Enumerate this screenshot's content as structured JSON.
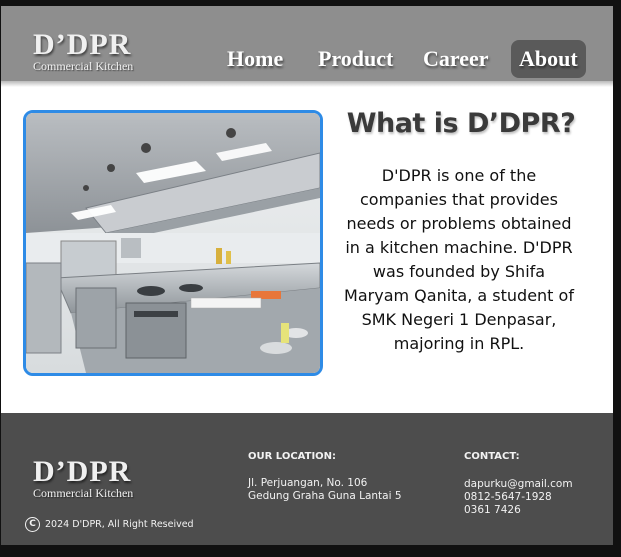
{
  "brand": {
    "name": "D’DPR",
    "tagline": "Commercial Kitchen"
  },
  "nav": {
    "items": [
      {
        "label": "Home",
        "active": false
      },
      {
        "label": "Product",
        "active": false
      },
      {
        "label": "Career",
        "active": false
      },
      {
        "label": "About",
        "active": true
      }
    ]
  },
  "hero": {
    "image_alt": "commercial kitchen photo",
    "title": "What is D’DPR?",
    "description": "D'DPR is one of the companies that provides needs or problems obtained in a kitchen machine. D'DPR was founded by Shifa Maryam Qanita, a student of SMK Negeri 1 Denpasar, majoring in RPL."
  },
  "footer": {
    "brand": {
      "name": "D’DPR",
      "tagline": "Commercial Kitchen"
    },
    "location": {
      "heading": "OUR LOCATION:",
      "line1": "Jl. Perjuangan, No. 106",
      "line2": "Gedung Graha Guna Lantai 5"
    },
    "contact": {
      "heading": "CONTACT:",
      "email": "dapurku@gmail.com",
      "phone1": "0812-5647-1928",
      "phone2": "0361 7426"
    },
    "copyright": "2024 D'DPR, All Right Reseived"
  },
  "colors": {
    "navbar": "#8e8e8e",
    "footer": "#4d4d4d",
    "image_border": "#2e8be6",
    "active_nav": "#5a5a5a"
  }
}
